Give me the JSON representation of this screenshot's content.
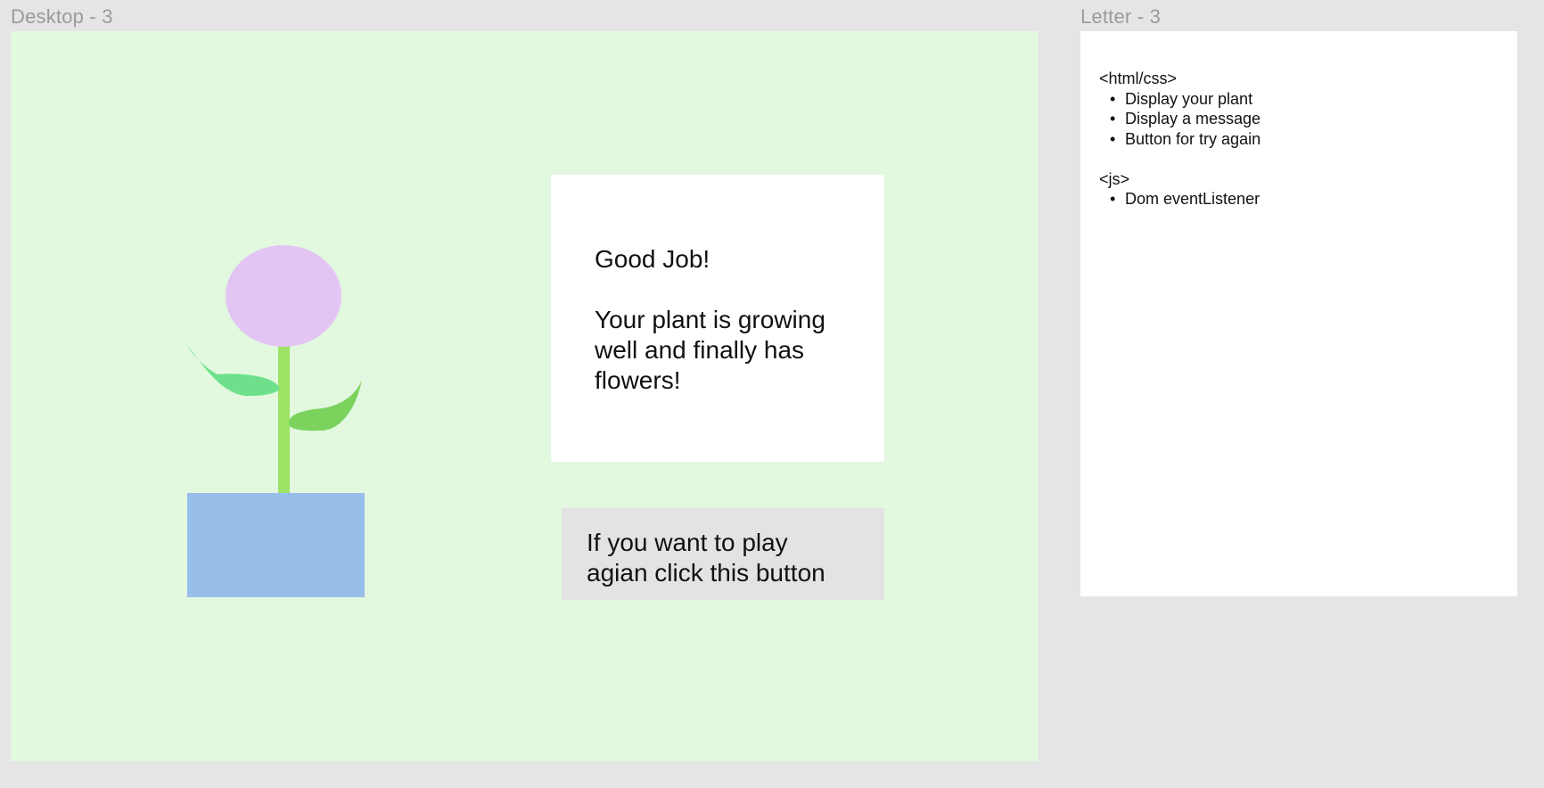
{
  "frames": {
    "desktop_label": "Desktop - 3",
    "letter_label": "Letter - 3"
  },
  "desktop": {
    "message": {
      "headline": "Good Job!",
      "body": "Your plant is growing well and finally has flowers!"
    },
    "try_again_button": {
      "line1": "If you want to play",
      "line2": "agian click this button"
    },
    "colors": {
      "background": "#e2f8df",
      "flower": "#e3c5f4",
      "stem": "#9ee365",
      "leaf_left": "#6ee08c",
      "leaf_right": "#7bd35e",
      "pot": "#98bfea",
      "button_bg": "#e3e3e3"
    }
  },
  "letter": {
    "sections": [
      {
        "heading": "<html/css>",
        "items": [
          "Display your plant",
          "Display a message",
          "Button for try again"
        ]
      },
      {
        "heading": "<js>",
        "items": [
          "Dom eventListener"
        ]
      }
    ],
    "bullet": "•"
  }
}
